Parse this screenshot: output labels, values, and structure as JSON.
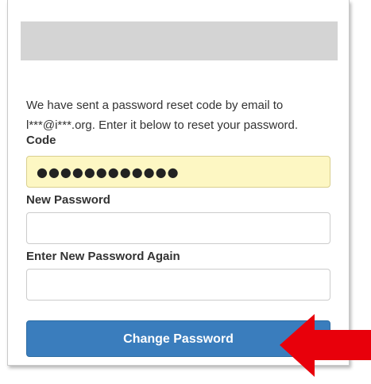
{
  "form": {
    "message_line1": "We have sent a password reset code by email to",
    "message_line2": "l***@i***.org. Enter it below to reset your password.",
    "code_label": "Code",
    "code_value": "●●●●●●●●●●●●",
    "new_password_label": "New Password",
    "new_password_value": "",
    "confirm_password_label": "Enter New Password Again",
    "confirm_password_value": "",
    "submit_label": "Change Password"
  },
  "colors": {
    "button": "#3a7dbd",
    "autofill": "#fdf7c3",
    "header_bar": "#d4d4d4",
    "arrow": "#e8000b"
  },
  "icons": {
    "annotation": "red-arrow-icon"
  }
}
